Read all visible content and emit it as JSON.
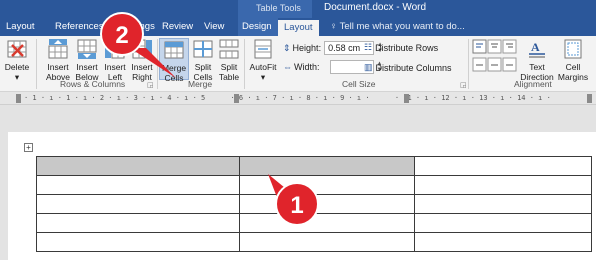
{
  "titlebar": {
    "contextual_label": "Table Tools",
    "document_title": "Document.docx - Word"
  },
  "tabs": [
    {
      "label": "Layout",
      "active": false
    },
    {
      "label": "References",
      "active": false
    },
    {
      "label": "Mailings",
      "active": false
    },
    {
      "label": "Review",
      "active": false
    },
    {
      "label": "View",
      "active": false
    },
    {
      "label": "Design",
      "active": false
    },
    {
      "label": "Layout",
      "active": true
    }
  ],
  "tell_me": "Tell me what you want to do...",
  "ribbon": {
    "delete": {
      "line1": "Delete",
      "line2": "▾"
    },
    "insert_above": {
      "line1": "Insert",
      "line2": "Above"
    },
    "insert_below": {
      "line1": "Insert",
      "line2": "Below"
    },
    "insert_left": {
      "line1": "Insert",
      "line2": "Left"
    },
    "insert_right": {
      "line1": "Insert",
      "line2": "Right"
    },
    "merge_cells": {
      "line1": "Merge",
      "line2": "Cells"
    },
    "split_cells": {
      "line1": "Split",
      "line2": "Cells"
    },
    "split_table": {
      "line1": "Split",
      "line2": "Table"
    },
    "autofit": {
      "line1": "AutoFit",
      "line2": "▾"
    },
    "height_label": "Height:",
    "height_value": "0.58 cm",
    "width_label": "Width:",
    "width_value": "",
    "distribute_rows": "Distribute Rows",
    "distribute_columns": "Distribute Columns",
    "text_direction": {
      "line1": "Text",
      "line2": "Direction"
    },
    "cell_margins": {
      "line1": "Cell",
      "line2": "Margins"
    },
    "groups": {
      "rows_columns": "Rows & Columns",
      "merge": "Merge",
      "cell_size": "Cell Size",
      "alignment": "Alignment"
    }
  },
  "ruler_text": "· 1 · ı · 1 · ı · 2 · ı · 3 · ı · 4 · ı · 5      · 6 · ı · 7 · ı · 8 · ı · 9 · ı ·      · 11 · ı · 12 · ı · 13 · ı · 14 · ı ·",
  "table": {
    "rows": 5,
    "columns": 3,
    "selected_row": 1,
    "selected_cells": 2
  },
  "callouts": [
    "1",
    "2"
  ],
  "colors": {
    "word_blue": "#2b579a",
    "callout_red": "#e0242b",
    "selection_gray": "#c8c8c8"
  }
}
